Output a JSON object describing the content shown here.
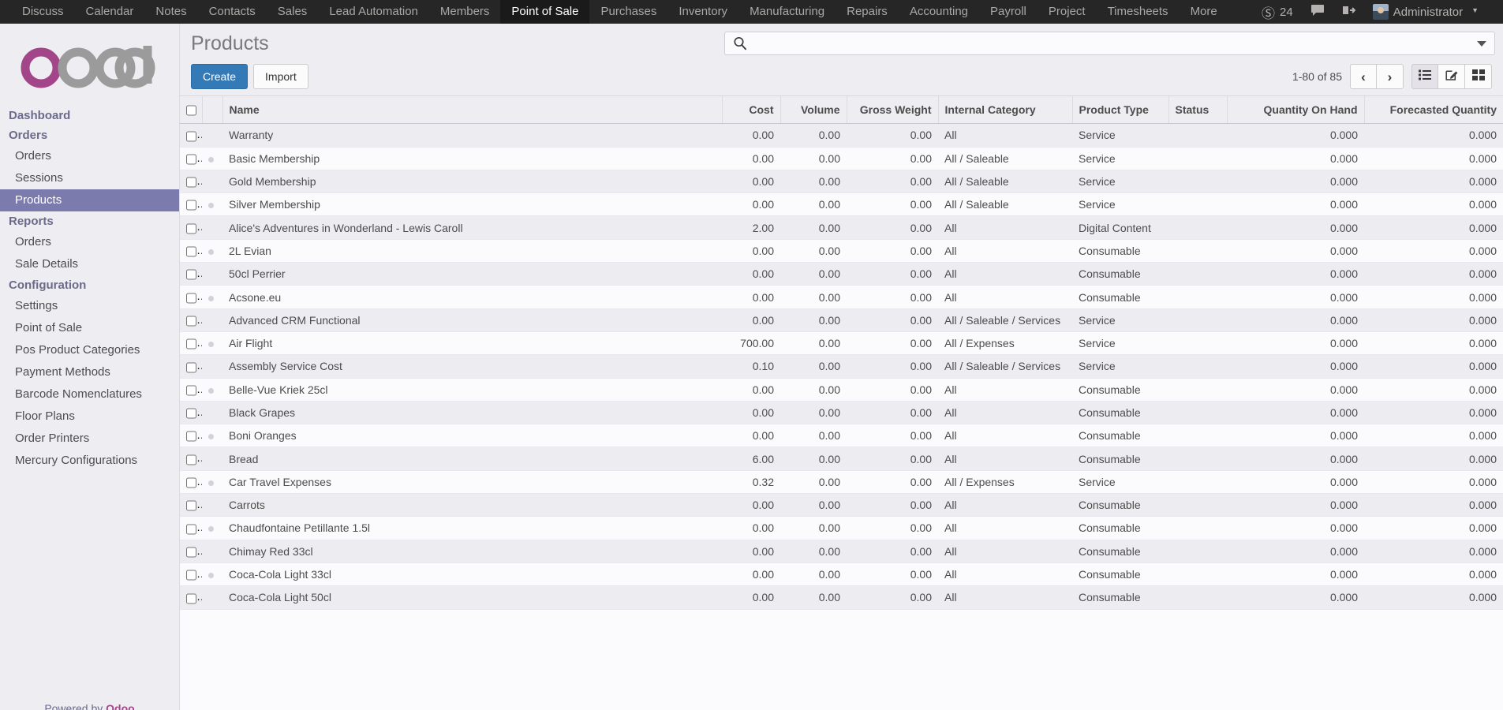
{
  "topnav": {
    "items": [
      {
        "label": "Discuss",
        "active": false
      },
      {
        "label": "Calendar",
        "active": false
      },
      {
        "label": "Notes",
        "active": false
      },
      {
        "label": "Contacts",
        "active": false
      },
      {
        "label": "Sales",
        "active": false
      },
      {
        "label": "Lead Automation",
        "active": false
      },
      {
        "label": "Members",
        "active": false
      },
      {
        "label": "Point of Sale",
        "active": true
      },
      {
        "label": "Purchases",
        "active": false
      },
      {
        "label": "Inventory",
        "active": false
      },
      {
        "label": "Manufacturing",
        "active": false
      },
      {
        "label": "Repairs",
        "active": false
      },
      {
        "label": "Accounting",
        "active": false
      },
      {
        "label": "Payroll",
        "active": false
      },
      {
        "label": "Project",
        "active": false
      },
      {
        "label": "Timesheets",
        "active": false
      },
      {
        "label": "More",
        "active": false,
        "caret": true
      }
    ],
    "mention_count": "24",
    "user_name": "Administrator"
  },
  "sidebar": {
    "logo_text": "odoo",
    "powered_prefix": "Powered by ",
    "powered_brand": "Odoo",
    "sections": [
      {
        "title": "Dashboard",
        "items": []
      },
      {
        "title": "Orders",
        "items": [
          {
            "label": "Orders",
            "active": false
          },
          {
            "label": "Sessions",
            "active": false
          },
          {
            "label": "Products",
            "active": true
          }
        ]
      },
      {
        "title": "Reports",
        "items": [
          {
            "label": "Orders",
            "active": false
          },
          {
            "label": "Sale Details",
            "active": false
          }
        ]
      },
      {
        "title": "Configuration",
        "items": [
          {
            "label": "Settings",
            "active": false
          },
          {
            "label": "Point of Sale",
            "active": false
          },
          {
            "label": "Pos Product Categories",
            "active": false
          },
          {
            "label": "Payment Methods",
            "active": false
          },
          {
            "label": "Barcode Nomenclatures",
            "active": false
          },
          {
            "label": "Floor Plans",
            "active": false
          },
          {
            "label": "Order Printers",
            "active": false
          },
          {
            "label": "Mercury Configurations",
            "active": false
          }
        ]
      }
    ]
  },
  "control_panel": {
    "title": "Products",
    "create_label": "Create",
    "import_label": "Import",
    "search_value": "",
    "search_placeholder": "",
    "pager": "1-80 of 85",
    "prev_glyph": "‹",
    "next_glyph": "›"
  },
  "table": {
    "columns": [
      {
        "label": "Name",
        "align": "left"
      },
      {
        "label": "Cost",
        "align": "right"
      },
      {
        "label": "Volume",
        "align": "right"
      },
      {
        "label": "Gross Weight",
        "align": "right"
      },
      {
        "label": "Internal Category",
        "align": "left"
      },
      {
        "label": "Product Type",
        "align": "left"
      },
      {
        "label": "Status",
        "align": "left"
      },
      {
        "label": "Quantity On Hand",
        "align": "right"
      },
      {
        "label": "Forecasted Quantity",
        "align": "right"
      }
    ],
    "rows": [
      {
        "name": "Warranty",
        "cost": "0.00",
        "volume": "0.00",
        "gross_weight": "0.00",
        "category": "All",
        "product_type": "Service",
        "status": "",
        "qty_on_hand": "0.000",
        "forecasted": "0.000"
      },
      {
        "name": "Basic Membership",
        "cost": "0.00",
        "volume": "0.00",
        "gross_weight": "0.00",
        "category": "All / Saleable",
        "product_type": "Service",
        "status": "",
        "qty_on_hand": "0.000",
        "forecasted": "0.000"
      },
      {
        "name": "Gold Membership",
        "cost": "0.00",
        "volume": "0.00",
        "gross_weight": "0.00",
        "category": "All / Saleable",
        "product_type": "Service",
        "status": "",
        "qty_on_hand": "0.000",
        "forecasted": "0.000"
      },
      {
        "name": "Silver Membership",
        "cost": "0.00",
        "volume": "0.00",
        "gross_weight": "0.00",
        "category": "All / Saleable",
        "product_type": "Service",
        "status": "",
        "qty_on_hand": "0.000",
        "forecasted": "0.000"
      },
      {
        "name": "Alice's Adventures in Wonderland - Lewis Caroll",
        "cost": "2.00",
        "volume": "0.00",
        "gross_weight": "0.00",
        "category": "All",
        "product_type": "Digital Content",
        "status": "",
        "qty_on_hand": "0.000",
        "forecasted": "0.000"
      },
      {
        "name": "2L Evian",
        "cost": "0.00",
        "volume": "0.00",
        "gross_weight": "0.00",
        "category": "All",
        "product_type": "Consumable",
        "status": "",
        "qty_on_hand": "0.000",
        "forecasted": "0.000"
      },
      {
        "name": "50cl Perrier",
        "cost": "0.00",
        "volume": "0.00",
        "gross_weight": "0.00",
        "category": "All",
        "product_type": "Consumable",
        "status": "",
        "qty_on_hand": "0.000",
        "forecasted": "0.000"
      },
      {
        "name": "Acsone.eu",
        "cost": "0.00",
        "volume": "0.00",
        "gross_weight": "0.00",
        "category": "All",
        "product_type": "Consumable",
        "status": "",
        "qty_on_hand": "0.000",
        "forecasted": "0.000"
      },
      {
        "name": "Advanced CRM Functional",
        "cost": "0.00",
        "volume": "0.00",
        "gross_weight": "0.00",
        "category": "All / Saleable / Services",
        "product_type": "Service",
        "status": "",
        "qty_on_hand": "0.000",
        "forecasted": "0.000"
      },
      {
        "name": "Air Flight",
        "cost": "700.00",
        "volume": "0.00",
        "gross_weight": "0.00",
        "category": "All / Expenses",
        "product_type": "Service",
        "status": "",
        "qty_on_hand": "0.000",
        "forecasted": "0.000"
      },
      {
        "name": "Assembly Service Cost",
        "cost": "0.10",
        "volume": "0.00",
        "gross_weight": "0.00",
        "category": "All / Saleable / Services",
        "product_type": "Service",
        "status": "",
        "qty_on_hand": "0.000",
        "forecasted": "0.000"
      },
      {
        "name": "Belle-Vue Kriek 25cl",
        "cost": "0.00",
        "volume": "0.00",
        "gross_weight": "0.00",
        "category": "All",
        "product_type": "Consumable",
        "status": "",
        "qty_on_hand": "0.000",
        "forecasted": "0.000"
      },
      {
        "name": "Black Grapes",
        "cost": "0.00",
        "volume": "0.00",
        "gross_weight": "0.00",
        "category": "All",
        "product_type": "Consumable",
        "status": "",
        "qty_on_hand": "0.000",
        "forecasted": "0.000"
      },
      {
        "name": "Boni Oranges",
        "cost": "0.00",
        "volume": "0.00",
        "gross_weight": "0.00",
        "category": "All",
        "product_type": "Consumable",
        "status": "",
        "qty_on_hand": "0.000",
        "forecasted": "0.000"
      },
      {
        "name": "Bread",
        "cost": "6.00",
        "volume": "0.00",
        "gross_weight": "0.00",
        "category": "All",
        "product_type": "Consumable",
        "status": "",
        "qty_on_hand": "0.000",
        "forecasted": "0.000"
      },
      {
        "name": "Car Travel Expenses",
        "cost": "0.32",
        "volume": "0.00",
        "gross_weight": "0.00",
        "category": "All / Expenses",
        "product_type": "Service",
        "status": "",
        "qty_on_hand": "0.000",
        "forecasted": "0.000"
      },
      {
        "name": "Carrots",
        "cost": "0.00",
        "volume": "0.00",
        "gross_weight": "0.00",
        "category": "All",
        "product_type": "Consumable",
        "status": "",
        "qty_on_hand": "0.000",
        "forecasted": "0.000"
      },
      {
        "name": "Chaudfontaine Petillante 1.5l",
        "cost": "0.00",
        "volume": "0.00",
        "gross_weight": "0.00",
        "category": "All",
        "product_type": "Consumable",
        "status": "",
        "qty_on_hand": "0.000",
        "forecasted": "0.000"
      },
      {
        "name": "Chimay Red 33cl",
        "cost": "0.00",
        "volume": "0.00",
        "gross_weight": "0.00",
        "category": "All",
        "product_type": "Consumable",
        "status": "",
        "qty_on_hand": "0.000",
        "forecasted": "0.000"
      },
      {
        "name": "Coca-Cola Light 33cl",
        "cost": "0.00",
        "volume": "0.00",
        "gross_weight": "0.00",
        "category": "All",
        "product_type": "Consumable",
        "status": "",
        "qty_on_hand": "0.000",
        "forecasted": "0.000"
      },
      {
        "name": "Coca-Cola Light 50cl",
        "cost": "0.00",
        "volume": "0.00",
        "gross_weight": "0.00",
        "category": "All",
        "product_type": "Consumable",
        "status": "",
        "qty_on_hand": "0.000",
        "forecasted": "0.000"
      }
    ]
  },
  "colors": {
    "brand_magenta": "#a24689",
    "sidebar_active": "#7c7bad",
    "primary_button": "#337ab7",
    "topbar": "#262626"
  }
}
